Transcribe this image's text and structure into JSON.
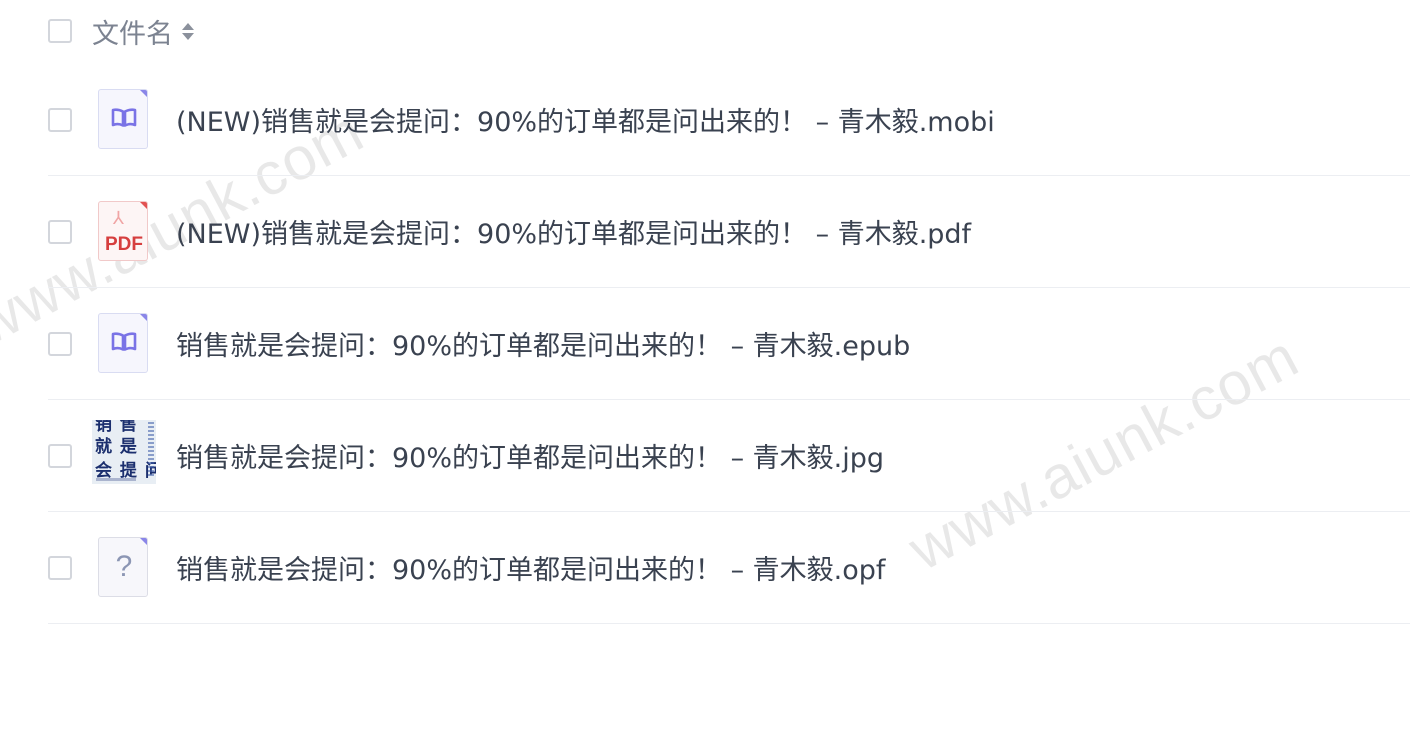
{
  "header": {
    "column_label": "文件名"
  },
  "files": [
    {
      "name": "(NEW)销售就是会提问：90%的订单都是问出来的！ – 青木毅.mobi",
      "icon": "ebook-icon"
    },
    {
      "name": "(NEW)销售就是会提问：90%的订单都是问出来的！ – 青木毅.pdf",
      "icon": "pdf-icon",
      "icon_text": "PDF"
    },
    {
      "name": "销售就是会提问：90%的订单都是问出来的！ – 青木毅.epub",
      "icon": "ebook-icon"
    },
    {
      "name": "销售就是会提问：90%的订单都是问出来的！ – 青木毅.jpg",
      "icon": "image-thumbnail",
      "thumb_lines": [
        "销 售",
        "就 是",
        "会 提 问"
      ]
    },
    {
      "name": "销售就是会提问：90%的订单都是问出来的！ – 青木毅.opf",
      "icon": "unknown-file-icon",
      "icon_text": "?"
    }
  ],
  "watermark": "www.aiunk.com",
  "colors": {
    "ebook_accent": "#8a86e8",
    "pdf_accent": "#d63e3e",
    "text": "#3a4250",
    "header_text": "#7c8391"
  }
}
